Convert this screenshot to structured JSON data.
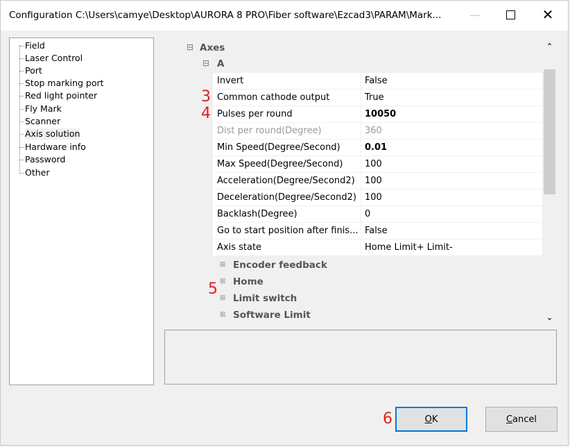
{
  "window": {
    "title": "Configuration C:\\Users\\camye\\Desktop\\AURORA 8 PRO\\Fiber software\\Ezcad3\\PARAM\\Mark...",
    "controls": {
      "minimize": "—",
      "maximize": "",
      "close": "✕"
    }
  },
  "tree": {
    "items": [
      {
        "label": "Field"
      },
      {
        "label": "Laser Control"
      },
      {
        "label": "Port"
      },
      {
        "label": "Stop marking port"
      },
      {
        "label": "Red light pointer"
      },
      {
        "label": "Fly Mark"
      },
      {
        "label": "Scanner"
      },
      {
        "label": "Axis solution",
        "selected": true
      },
      {
        "label": "Hardware info"
      },
      {
        "label": "Password"
      },
      {
        "label": "Other"
      }
    ]
  },
  "grid": {
    "category": "Axes",
    "subcategory": "A",
    "collapse_glyph": "⊟",
    "expand_glyph": "⊞",
    "rows": [
      {
        "name": "Invert",
        "value": "False"
      },
      {
        "name": "Common cathode output",
        "value": "True"
      },
      {
        "name": "Pulses per round",
        "value": "10050",
        "bold": true
      },
      {
        "name": "Dist per round(Degree)",
        "value": "360",
        "disabled": true
      },
      {
        "name": "Min Speed(Degree/Second)",
        "value": "0.01",
        "bold": true
      },
      {
        "name": "Max Speed(Degree/Second)",
        "value": "100"
      },
      {
        "name": "Acceleration(Degree/Second2)",
        "value": "100"
      },
      {
        "name": "Deceleration(Degree/Second2)",
        "value": "100"
      },
      {
        "name": "Backlash(Degree)",
        "value": "0"
      },
      {
        "name": "Go to start position after finis...",
        "value": "False"
      },
      {
        "name": "Axis state",
        "value": "Home Limit+ Limit-"
      }
    ],
    "collapsed": [
      {
        "label": "Encoder feedback"
      },
      {
        "label": "Home"
      },
      {
        "label": "Limit switch"
      },
      {
        "label": "Software Limit"
      }
    ]
  },
  "scrollbar": {
    "up": "⌃",
    "down": "⌄"
  },
  "annotations": {
    "a3": "3",
    "a4": "4",
    "a5": "5",
    "a6": "6"
  },
  "buttons": {
    "ok_accel": "O",
    "ok_rest": "K",
    "cancel_accel": "C",
    "cancel_rest": "ancel"
  },
  "colors": {
    "accent": "#0078d7",
    "annotation": "#e02020"
  }
}
